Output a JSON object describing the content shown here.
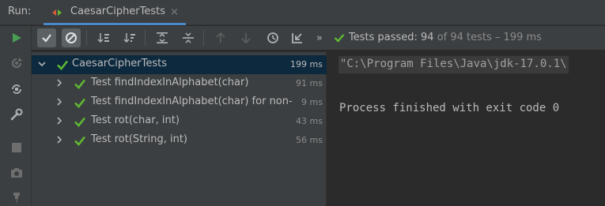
{
  "panel": {
    "run_label": "Run:"
  },
  "tab": {
    "label": "CaesarCipherTests",
    "close": "×"
  },
  "toolbar": {
    "more": "»",
    "status_passed": "Tests passed: 94",
    "status_detail": "of 94 tests – 199 ms"
  },
  "tree": {
    "root": {
      "label": "CaesarCipherTests",
      "time": "199 ms"
    },
    "items": [
      {
        "label": "Test findIndexInAlphabet(char)",
        "time": "91 ms"
      },
      {
        "label": "Test findIndexInAlphabet(char) for non-",
        "time": "9 ms"
      },
      {
        "label": "Test rot(char, int)",
        "time": "43 ms"
      },
      {
        "label": "Test rot(String, int)",
        "time": "56 ms"
      }
    ]
  },
  "console": {
    "command": "\"C:\\Program Files\\Java\\jdk-17.0.1\\",
    "exit_message": "Process finished with exit code 0"
  },
  "colors": {
    "pass_green": "#5fb832",
    "run_green": "#499c54",
    "selection": "#0d293e",
    "tab_underline": "#4a88c7"
  }
}
